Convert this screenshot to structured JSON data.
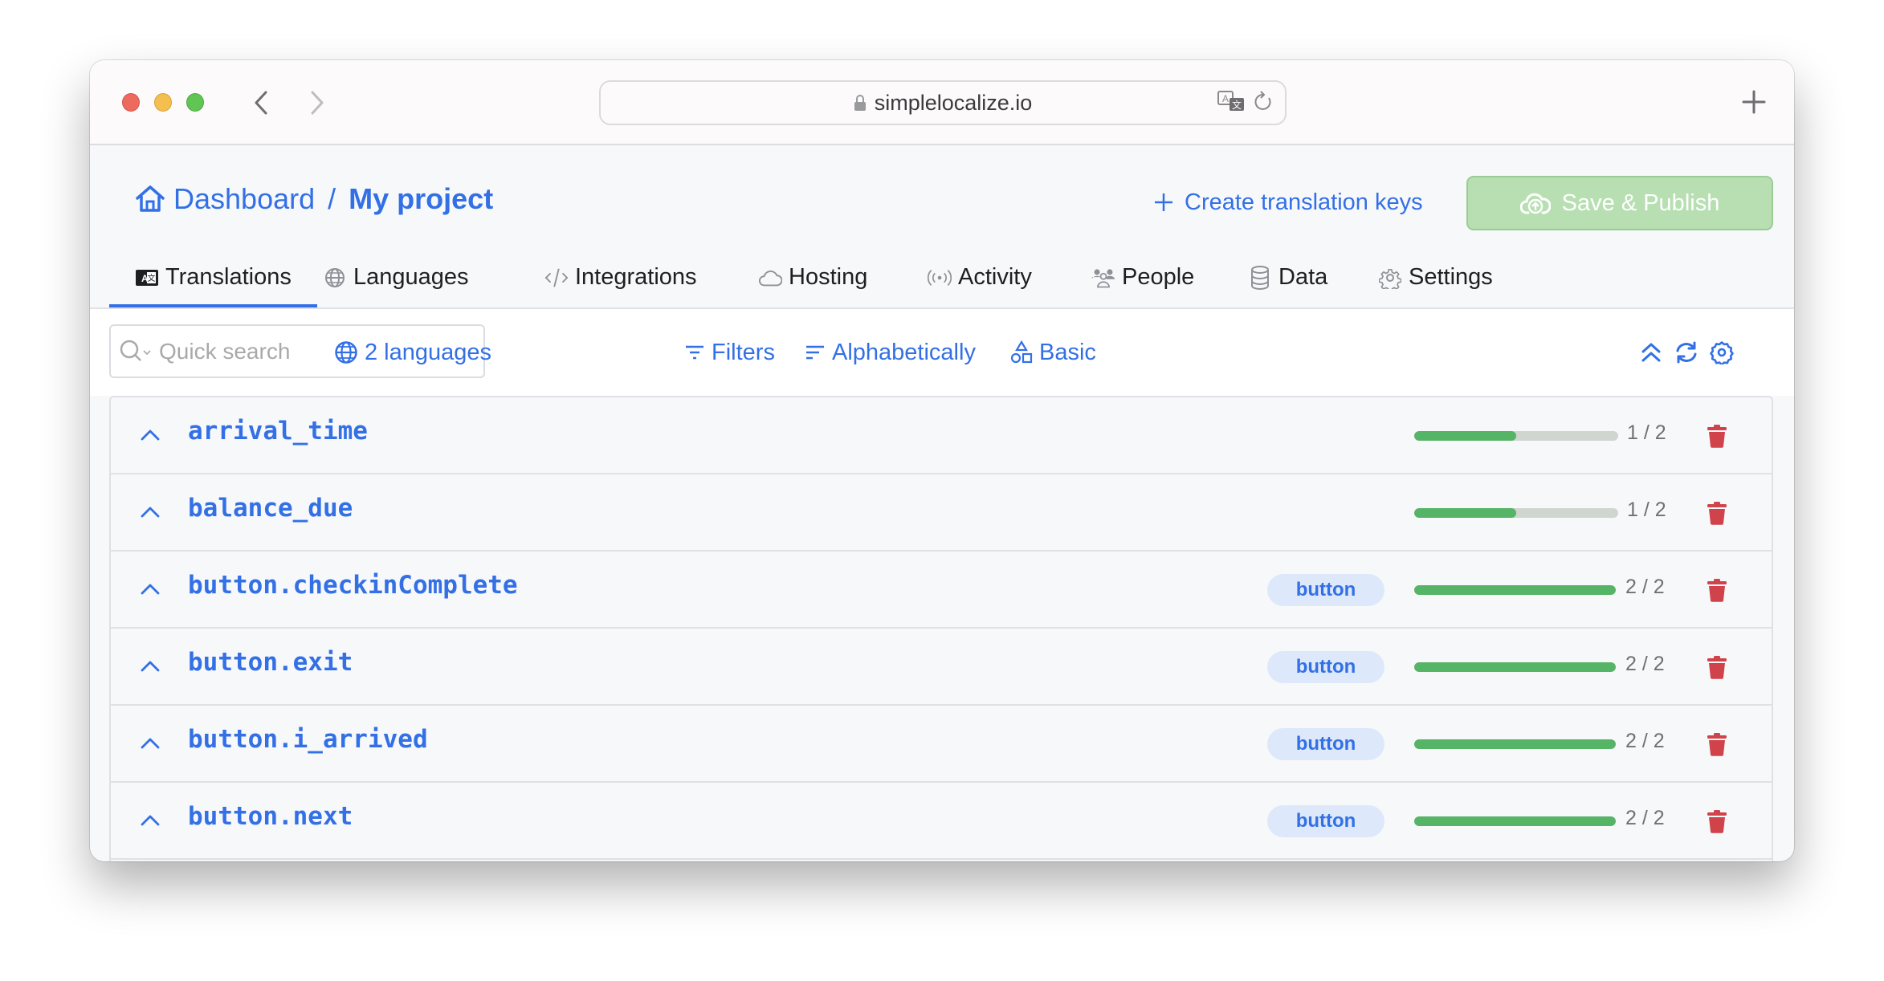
{
  "browser": {
    "url": "simplelocalize.io",
    "icons": {
      "back": "chevron-left-icon",
      "forward": "chevron-right-icon",
      "lock": "lock-icon",
      "translate": "translate-icon",
      "reload": "reload-icon",
      "new_tab": "plus-icon"
    }
  },
  "header": {
    "breadcrumb": {
      "home_icon": "home-icon",
      "dashboard": "Dashboard",
      "separator": "/",
      "project": "My project"
    },
    "create_keys_label": "Create translation keys",
    "save_publish_label": "Save & Publish"
  },
  "tabs": [
    {
      "label": "Translations",
      "icon": "translate-box-icon",
      "active": true
    },
    {
      "label": "Languages",
      "icon": "globe-icon",
      "active": false
    },
    {
      "label": "Integrations",
      "icon": "code-icon",
      "active": false
    },
    {
      "label": "Hosting",
      "icon": "cloud-icon",
      "active": false
    },
    {
      "label": "Activity",
      "icon": "broadcast-icon",
      "active": false
    },
    {
      "label": "People",
      "icon": "people-icon",
      "active": false
    },
    {
      "label": "Data",
      "icon": "database-icon",
      "active": false
    },
    {
      "label": "Settings",
      "icon": "gear-icon",
      "active": false
    }
  ],
  "toolbar": {
    "search_placeholder": "Quick search",
    "search_value": "",
    "languages_label": "2 languages",
    "filters_label": "Filters",
    "sort_label": "Alphabetically",
    "view_label": "Basic",
    "icons": [
      "collapse-all-icon",
      "refresh-icon",
      "settings-icon"
    ]
  },
  "colors": {
    "accent": "#3370e6",
    "success": "#55b466",
    "danger": "#d0434a",
    "save_button": "#b7dfb2",
    "badge_bg": "#dde9fb"
  },
  "keys": [
    {
      "key": "arrival_time",
      "tag": "",
      "translated": 1,
      "total": 2,
      "count_label": "1 / 2"
    },
    {
      "key": "balance_due",
      "tag": "",
      "translated": 1,
      "total": 2,
      "count_label": "1 / 2"
    },
    {
      "key": "button.checkinComplete",
      "tag": "button",
      "translated": 2,
      "total": 2,
      "count_label": "2 / 2"
    },
    {
      "key": "button.exit",
      "tag": "button",
      "translated": 2,
      "total": 2,
      "count_label": "2 / 2"
    },
    {
      "key": "button.i_arrived",
      "tag": "button",
      "translated": 2,
      "total": 2,
      "count_label": "2 / 2"
    },
    {
      "key": "button.next",
      "tag": "button",
      "translated": 2,
      "total": 2,
      "count_label": "2 / 2"
    }
  ]
}
